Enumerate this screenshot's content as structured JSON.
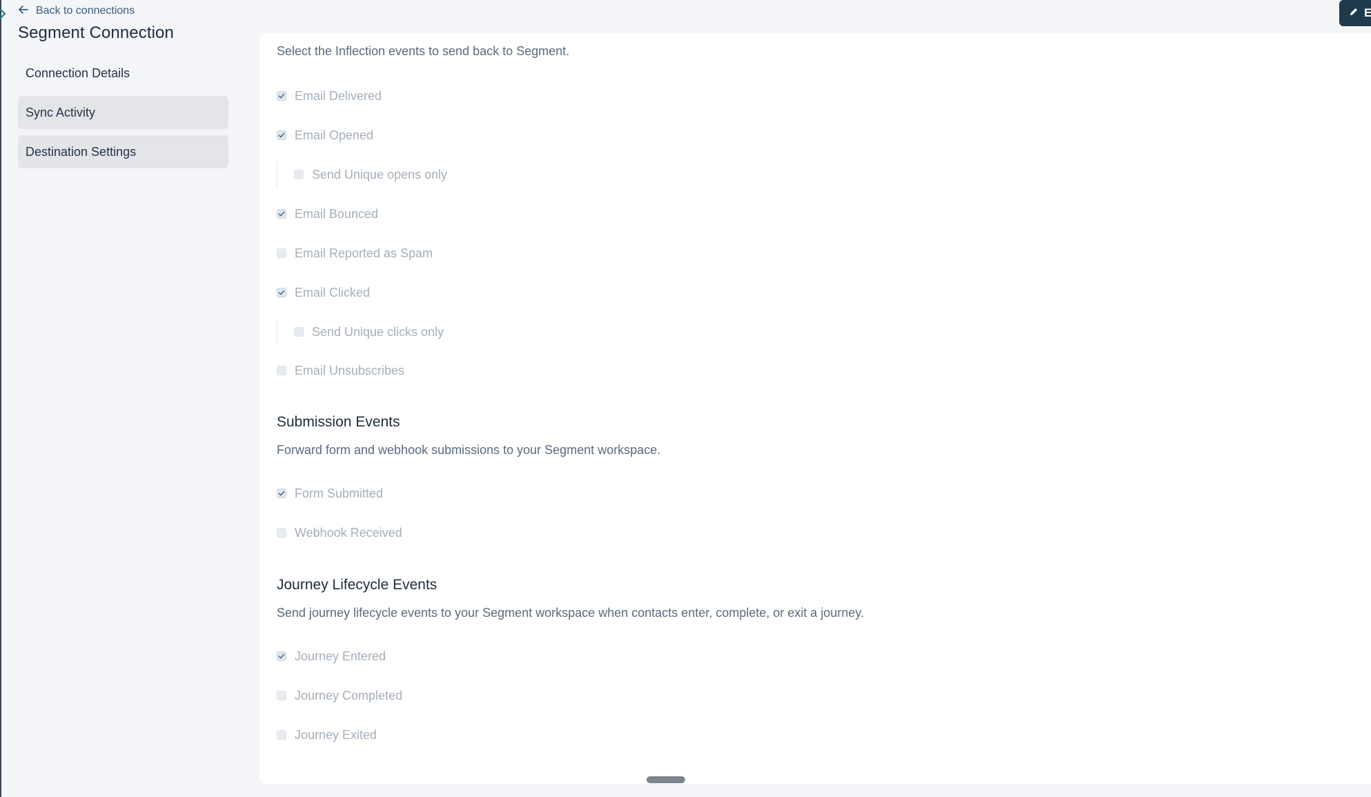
{
  "header": {
    "back_label": "Back to connections",
    "title": "Segment Connection",
    "edit_label": "Ed"
  },
  "nav": {
    "items": [
      {
        "label": "Connection Details"
      },
      {
        "label": "Sync Activity"
      },
      {
        "label": "Destination Settings"
      }
    ]
  },
  "email_section": {
    "description": "Select the Inflection events to send back to Segment.",
    "options": [
      {
        "label": "Email Delivered",
        "checked": true
      },
      {
        "label": "Email Opened",
        "checked": true
      },
      {
        "label": "Send Unique opens only",
        "checked": false,
        "nested": true
      },
      {
        "label": "Email Bounced",
        "checked": true
      },
      {
        "label": "Email Reported as Spam",
        "checked": false
      },
      {
        "label": "Email Clicked",
        "checked": true
      },
      {
        "label": "Send Unique clicks only",
        "checked": false,
        "nested": true
      },
      {
        "label": "Email Unsubscribes",
        "checked": false
      }
    ]
  },
  "submission_section": {
    "title": "Submission Events",
    "description": "Forward form and webhook submissions to your Segment workspace.",
    "options": [
      {
        "label": "Form Submitted",
        "checked": true
      },
      {
        "label": "Webhook Received",
        "checked": false
      }
    ]
  },
  "journey_section": {
    "title": "Journey Lifecycle Events",
    "description": "Send journey lifecycle events to your Segment workspace when contacts enter, complete, or exit a journey.",
    "options": [
      {
        "label": "Journey Entered",
        "checked": true
      },
      {
        "label": "Journey Completed",
        "checked": false
      },
      {
        "label": "Journey Exited",
        "checked": false
      }
    ]
  },
  "colors": {
    "accent_button": "#1f3a4d",
    "nav_active": "#e3e5e8",
    "muted_text": "#a6afb9"
  },
  "icons": [
    "chevron-right-icon",
    "arrow-left-icon",
    "pencil-icon",
    "checkmark-icon"
  ]
}
